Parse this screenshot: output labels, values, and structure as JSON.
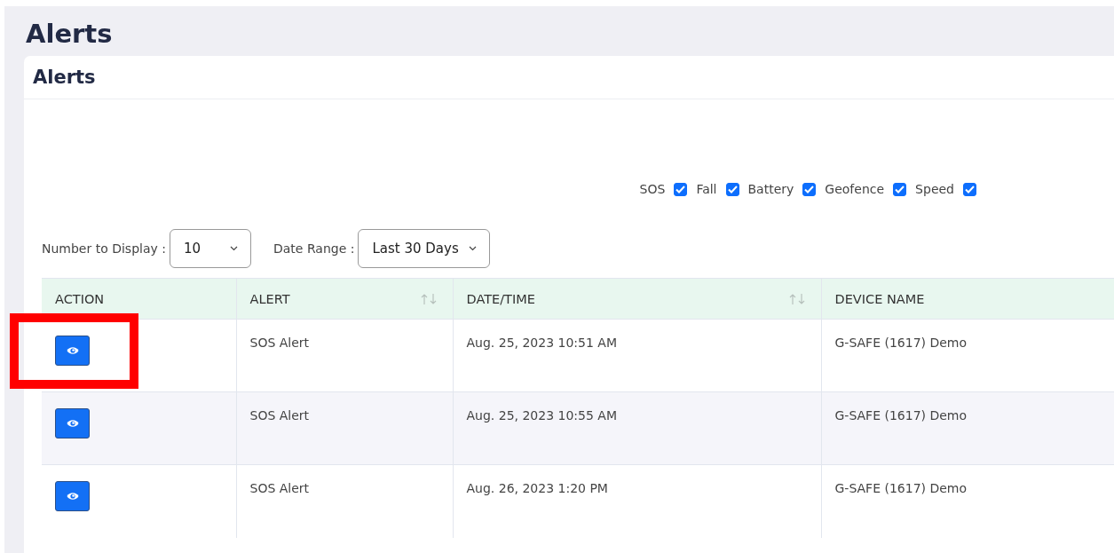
{
  "page_title": "Alerts",
  "card": {
    "title": "Alerts"
  },
  "filters": [
    {
      "label": "SOS",
      "checked": true
    },
    {
      "label": "Fall",
      "checked": true
    },
    {
      "label": "Battery",
      "checked": true
    },
    {
      "label": "Geofence",
      "checked": true
    },
    {
      "label": "Speed",
      "checked": true
    }
  ],
  "number_to_display": {
    "label": "Number to Display :",
    "value": "10"
  },
  "date_range": {
    "label": "Date Range :",
    "value": "Last 30 Days"
  },
  "table": {
    "columns": [
      {
        "label": "ACTION",
        "sortable": false
      },
      {
        "label": "ALERT",
        "sortable": true
      },
      {
        "label": "DATE/TIME",
        "sortable": true
      },
      {
        "label": "DEVICE NAME",
        "sortable": false
      }
    ],
    "rows": [
      {
        "alert": "SOS Alert",
        "datetime": "Aug. 25, 2023 10:51 AM",
        "device": "G-SAFE (1617) Demo",
        "highlighted": true
      },
      {
        "alert": "SOS Alert",
        "datetime": "Aug. 25, 2023 10:55 AM",
        "device": "G-SAFE (1617) Demo",
        "highlighted": false
      },
      {
        "alert": "SOS Alert",
        "datetime": "Aug. 26, 2023 1:20 PM",
        "device": "G-SAFE (1617) Demo",
        "highlighted": false
      }
    ]
  }
}
